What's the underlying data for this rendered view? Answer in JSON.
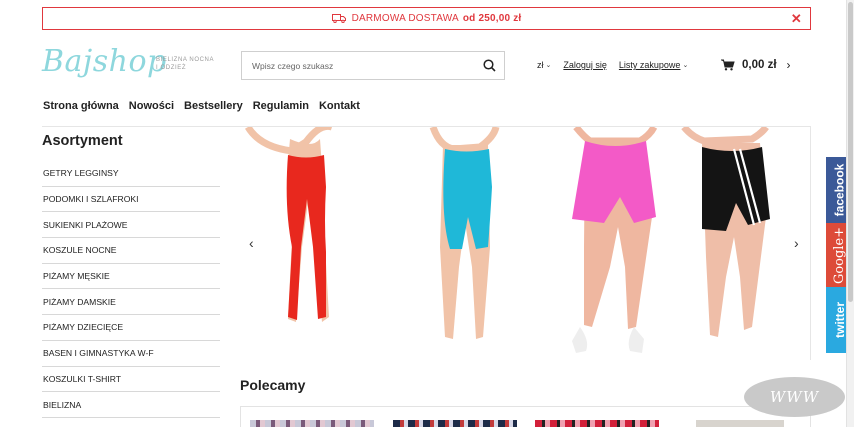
{
  "promo": {
    "text": "DARMOWA DOSTAWA",
    "amount": "od 250,00 zł",
    "close": "✕",
    "icon": "truck-icon",
    "color": "#e0383e"
  },
  "header": {
    "logo": "Bajshop",
    "tagline_line1": "BIELIZNA NOCNA",
    "tagline_line2": "I ODZIEŻ",
    "search_placeholder": "Wpisz czego szukasz",
    "currency": "zł",
    "login": "Zaloguj się",
    "wishlist": "Listy zakupowe",
    "cart_total": "0,00 zł"
  },
  "mainnav": [
    "Strona główna",
    "Nowości",
    "Bestsellery",
    "Regulamin",
    "Kontakt"
  ],
  "sidebar": {
    "title": "Asortyment",
    "items": [
      "GETRY LEGGINSY",
      "PODOMKI I SZLAFROKI",
      "SUKIENKI PLAŻOWE",
      "KOSZULE NOCNE",
      "PIŻAMY MĘSKIE",
      "PIŻAMY DAMSKIE",
      "PIŻAMY DZIECIĘCE",
      "BASEN I GIMNASTYKA W-F",
      "KOSZULKI T-SHIRT",
      "BIELIZNA"
    ]
  },
  "slider": {
    "prev": "‹",
    "next": "›",
    "slides": [
      {
        "color": "#e8281e"
      },
      {
        "color": "#1fb8d8"
      },
      {
        "color": "#f35ac7"
      },
      {
        "color": "#141414"
      }
    ]
  },
  "section": {
    "title": "Polecamy"
  },
  "social": {
    "facebook": "facebook",
    "google": "Google+",
    "twitter": "twitter"
  },
  "watermark": "WWW"
}
